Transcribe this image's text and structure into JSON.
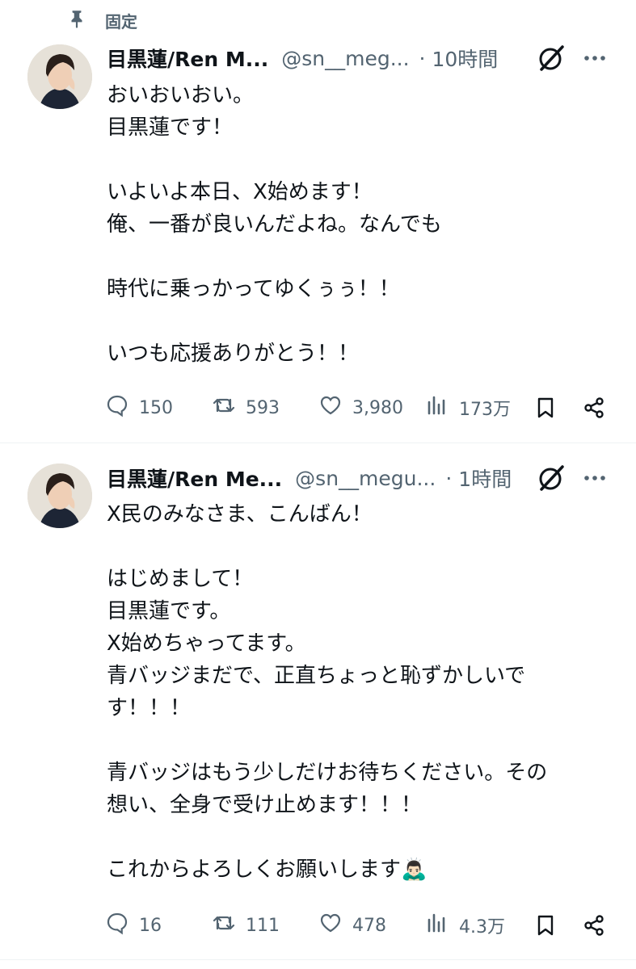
{
  "pinned_label": "固定",
  "tweets": [
    {
      "name": "目黒蓮/Ren M...",
      "handle": "@sn__meg...",
      "dot": "·",
      "time": "10時間",
      "lines": [
        "おいおいおい。",
        "目黒蓮です！",
        "",
        "いよいよ本日、X始めます！",
        "俺、一番が良いんだよね。なんでも",
        "",
        "時代に乗っかってゆくぅぅ！！",
        "",
        "いつも応援ありがとう！！"
      ],
      "replies": "150",
      "reposts": "593",
      "likes": "3,980",
      "views": "173万"
    },
    {
      "name": "目黒蓮/Ren Me...",
      "handle": "@sn__megu...",
      "dot": "·",
      "time": "1時間",
      "lines": [
        "X民のみなさま、こんばん！",
        "",
        "はじめまして！",
        "目黒蓮です。",
        "X始めちゃってます。",
        "青バッジまだで、正直ちょっと恥ずかしいで",
        "す！！！",
        "",
        "青バッジはもう少しだけお待ちください。その",
        "想い、全身で受け止めます！！！",
        "",
        "これからよろしくお願いします🙇🏻‍♂️"
      ],
      "replies": "16",
      "reposts": "111",
      "likes": "478",
      "views": "4.3万"
    }
  ],
  "colors": {
    "text": "#0f1419",
    "secondary": "#536471",
    "divider": "#eff3f4"
  }
}
